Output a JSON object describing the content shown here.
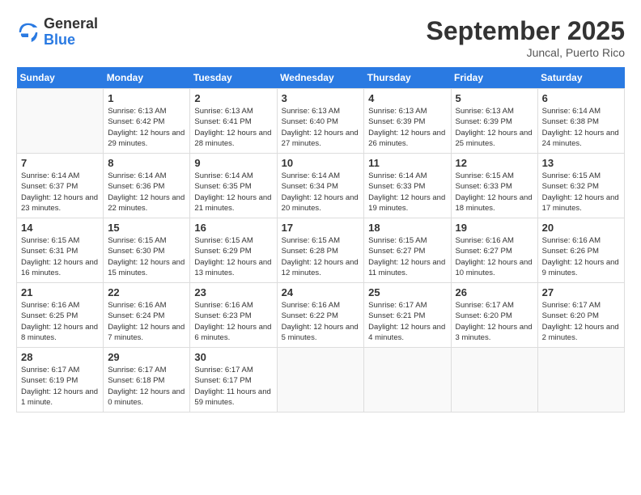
{
  "header": {
    "logo_general": "General",
    "logo_blue": "Blue",
    "month": "September 2025",
    "location": "Juncal, Puerto Rico"
  },
  "days_of_week": [
    "Sunday",
    "Monday",
    "Tuesday",
    "Wednesday",
    "Thursday",
    "Friday",
    "Saturday"
  ],
  "weeks": [
    [
      {
        "day": "",
        "info": ""
      },
      {
        "day": "1",
        "info": "Sunrise: 6:13 AM\nSunset: 6:42 PM\nDaylight: 12 hours and 29 minutes."
      },
      {
        "day": "2",
        "info": "Sunrise: 6:13 AM\nSunset: 6:41 PM\nDaylight: 12 hours and 28 minutes."
      },
      {
        "day": "3",
        "info": "Sunrise: 6:13 AM\nSunset: 6:40 PM\nDaylight: 12 hours and 27 minutes."
      },
      {
        "day": "4",
        "info": "Sunrise: 6:13 AM\nSunset: 6:39 PM\nDaylight: 12 hours and 26 minutes."
      },
      {
        "day": "5",
        "info": "Sunrise: 6:13 AM\nSunset: 6:39 PM\nDaylight: 12 hours and 25 minutes."
      },
      {
        "day": "6",
        "info": "Sunrise: 6:14 AM\nSunset: 6:38 PM\nDaylight: 12 hours and 24 minutes."
      }
    ],
    [
      {
        "day": "7",
        "info": "Sunrise: 6:14 AM\nSunset: 6:37 PM\nDaylight: 12 hours and 23 minutes."
      },
      {
        "day": "8",
        "info": "Sunrise: 6:14 AM\nSunset: 6:36 PM\nDaylight: 12 hours and 22 minutes."
      },
      {
        "day": "9",
        "info": "Sunrise: 6:14 AM\nSunset: 6:35 PM\nDaylight: 12 hours and 21 minutes."
      },
      {
        "day": "10",
        "info": "Sunrise: 6:14 AM\nSunset: 6:34 PM\nDaylight: 12 hours and 20 minutes."
      },
      {
        "day": "11",
        "info": "Sunrise: 6:14 AM\nSunset: 6:33 PM\nDaylight: 12 hours and 19 minutes."
      },
      {
        "day": "12",
        "info": "Sunrise: 6:15 AM\nSunset: 6:33 PM\nDaylight: 12 hours and 18 minutes."
      },
      {
        "day": "13",
        "info": "Sunrise: 6:15 AM\nSunset: 6:32 PM\nDaylight: 12 hours and 17 minutes."
      }
    ],
    [
      {
        "day": "14",
        "info": "Sunrise: 6:15 AM\nSunset: 6:31 PM\nDaylight: 12 hours and 16 minutes."
      },
      {
        "day": "15",
        "info": "Sunrise: 6:15 AM\nSunset: 6:30 PM\nDaylight: 12 hours and 15 minutes."
      },
      {
        "day": "16",
        "info": "Sunrise: 6:15 AM\nSunset: 6:29 PM\nDaylight: 12 hours and 13 minutes."
      },
      {
        "day": "17",
        "info": "Sunrise: 6:15 AM\nSunset: 6:28 PM\nDaylight: 12 hours and 12 minutes."
      },
      {
        "day": "18",
        "info": "Sunrise: 6:15 AM\nSunset: 6:27 PM\nDaylight: 12 hours and 11 minutes."
      },
      {
        "day": "19",
        "info": "Sunrise: 6:16 AM\nSunset: 6:27 PM\nDaylight: 12 hours and 10 minutes."
      },
      {
        "day": "20",
        "info": "Sunrise: 6:16 AM\nSunset: 6:26 PM\nDaylight: 12 hours and 9 minutes."
      }
    ],
    [
      {
        "day": "21",
        "info": "Sunrise: 6:16 AM\nSunset: 6:25 PM\nDaylight: 12 hours and 8 minutes."
      },
      {
        "day": "22",
        "info": "Sunrise: 6:16 AM\nSunset: 6:24 PM\nDaylight: 12 hours and 7 minutes."
      },
      {
        "day": "23",
        "info": "Sunrise: 6:16 AM\nSunset: 6:23 PM\nDaylight: 12 hours and 6 minutes."
      },
      {
        "day": "24",
        "info": "Sunrise: 6:16 AM\nSunset: 6:22 PM\nDaylight: 12 hours and 5 minutes."
      },
      {
        "day": "25",
        "info": "Sunrise: 6:17 AM\nSunset: 6:21 PM\nDaylight: 12 hours and 4 minutes."
      },
      {
        "day": "26",
        "info": "Sunrise: 6:17 AM\nSunset: 6:20 PM\nDaylight: 12 hours and 3 minutes."
      },
      {
        "day": "27",
        "info": "Sunrise: 6:17 AM\nSunset: 6:20 PM\nDaylight: 12 hours and 2 minutes."
      }
    ],
    [
      {
        "day": "28",
        "info": "Sunrise: 6:17 AM\nSunset: 6:19 PM\nDaylight: 12 hours and 1 minute."
      },
      {
        "day": "29",
        "info": "Sunrise: 6:17 AM\nSunset: 6:18 PM\nDaylight: 12 hours and 0 minutes."
      },
      {
        "day": "30",
        "info": "Sunrise: 6:17 AM\nSunset: 6:17 PM\nDaylight: 11 hours and 59 minutes."
      },
      {
        "day": "",
        "info": ""
      },
      {
        "day": "",
        "info": ""
      },
      {
        "day": "",
        "info": ""
      },
      {
        "day": "",
        "info": ""
      }
    ]
  ]
}
